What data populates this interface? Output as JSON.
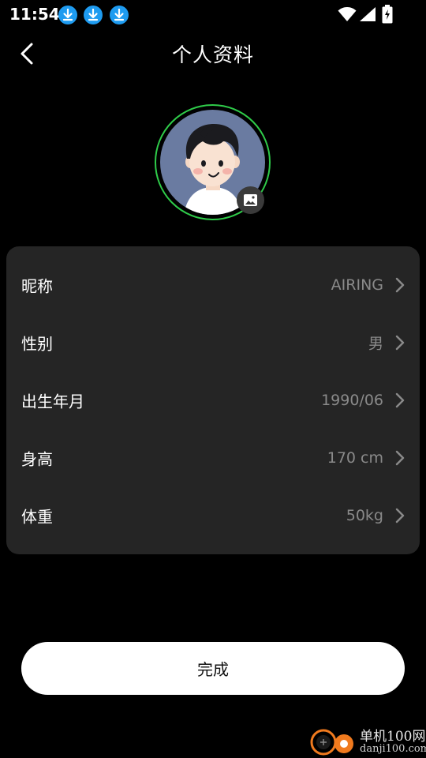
{
  "status_bar": {
    "time": "11:54",
    "notification_icons": [
      "download-icon",
      "download-icon",
      "download-icon"
    ],
    "accent_color": "#1e9bf0"
  },
  "header": {
    "back_icon": "chevron-left-icon",
    "title": "个人资料"
  },
  "avatar": {
    "ring_color": "#2fcc4a",
    "badge_icon": "image-icon"
  },
  "profile": {
    "rows": [
      {
        "label": "昵称",
        "value": "AIRING"
      },
      {
        "label": "性别",
        "value": "男"
      },
      {
        "label": "出生年月",
        "value": "1990/06"
      },
      {
        "label": "身高",
        "value": "170 cm"
      },
      {
        "label": "体重",
        "value": "50kg"
      }
    ]
  },
  "footer": {
    "done_label": "完成"
  },
  "watermark": {
    "name": "单机100网",
    "url": "danji100.com"
  }
}
